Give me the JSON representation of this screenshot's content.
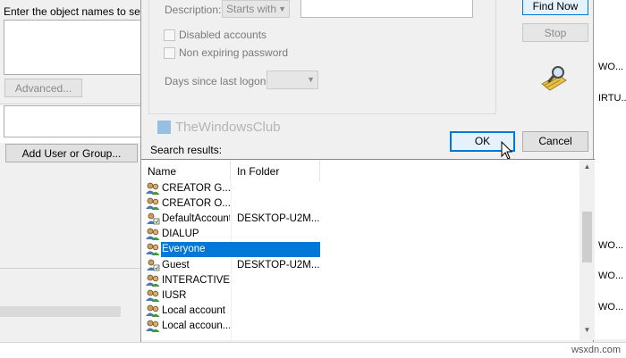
{
  "background_dialog": {
    "prompt_label": "Enter the object names to select",
    "advanced_button": "Advanced...",
    "add_button": "Add User or Group..."
  },
  "find_dialog": {
    "description_label": "Description:",
    "description_operator": "Starts with",
    "disabled_accounts_label": "Disabled accounts",
    "non_expiring_label": "Non expiring password",
    "days_since_label": "Days since last logon:",
    "find_now_button": "Find Now",
    "stop_button": "Stop",
    "watermark": "TheWindowsClub",
    "ok_button": "OK",
    "cancel_button": "Cancel",
    "search_results_label": "Search results:",
    "columns": {
      "name": "Name",
      "folder": "In Folder"
    },
    "results": [
      {
        "name": "CREATOR G...",
        "folder": "",
        "icon": "group-icon"
      },
      {
        "name": "CREATOR O...",
        "folder": "",
        "icon": "group-icon"
      },
      {
        "name": "DefaultAccount",
        "folder": "DESKTOP-U2M...",
        "icon": "user-icon"
      },
      {
        "name": "DIALUP",
        "folder": "",
        "icon": "group-icon"
      },
      {
        "name": "Everyone",
        "folder": "",
        "icon": "group-icon",
        "selected": true
      },
      {
        "name": "Guest",
        "folder": "DESKTOP-U2M...",
        "icon": "user-icon"
      },
      {
        "name": "INTERACTIVE",
        "folder": "",
        "icon": "group-icon"
      },
      {
        "name": "IUSR",
        "folder": "",
        "icon": "group-icon"
      },
      {
        "name": "Local account",
        "folder": "",
        "icon": "group-icon"
      },
      {
        "name": "Local accoun...",
        "folder": "",
        "icon": "group-icon"
      }
    ]
  },
  "right_panel": {
    "items": [
      "WO...",
      "IRTU...",
      "WO...",
      "WO...",
      "WO..."
    ]
  },
  "footer": {
    "site_text": "wsxdn.com"
  },
  "colors": {
    "accent": "#0078d7",
    "selected_row": "#0078d7",
    "background": "#f0f0f0"
  }
}
